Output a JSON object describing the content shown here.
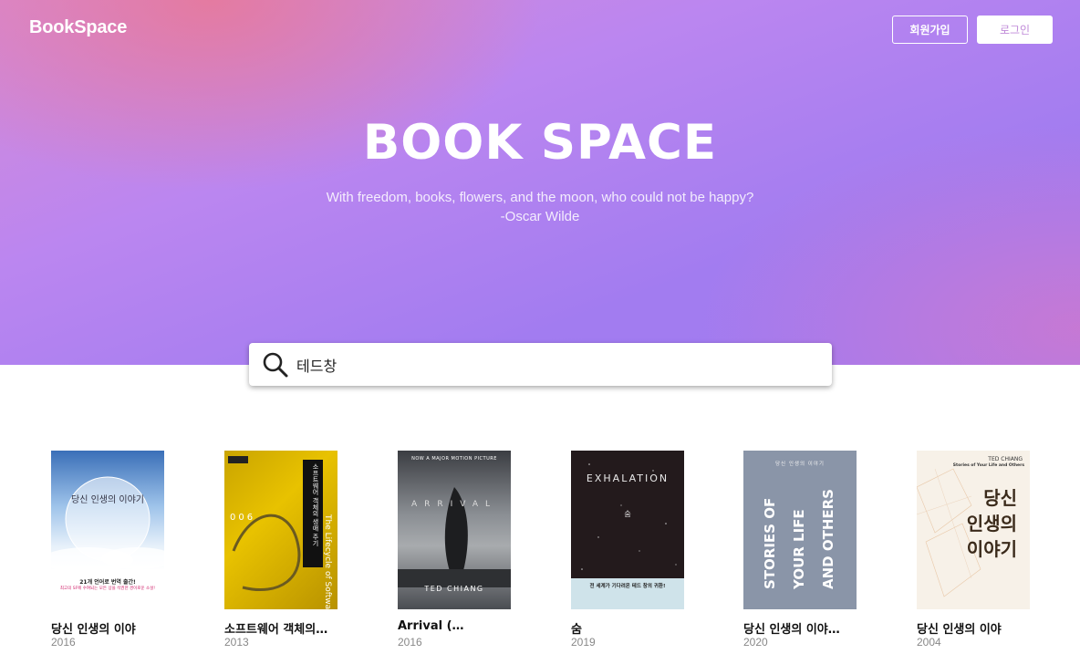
{
  "header": {
    "brand": "BookSpace",
    "signup_label": "회원가입",
    "login_label": "로그인"
  },
  "hero": {
    "title": "BOOK SPACE",
    "quote": "With freedom, books, flowers, and the moon, who could not be happy?",
    "author": "-Oscar Wilde"
  },
  "search": {
    "value": "테드창",
    "icon": "search-icon"
  },
  "books": [
    {
      "title": "당신 인생의 이야",
      "year": "2016",
      "cover": {
        "title": "당신 인생의 이야기",
        "line1": "21개 언어로 번역 출간!",
        "line2": "최고의 SF에 수여되는 모든 상을 석권한 경이로운 소설!"
      }
    },
    {
      "title": "소프트웨어 객체의…",
      "year": "2013",
      "cover": {
        "number": "006",
        "vertical_title": "소프트웨어 객체의 생애 주기",
        "spine_text": "The Lifecycle of Software Objects"
      }
    },
    {
      "title": "Arrival (…",
      "year": "2016",
      "cover": {
        "tagline": "NOW A MAJOR MOTION PICTURE",
        "title": "ARRIVAL",
        "author": "TED CHIANG"
      }
    },
    {
      "title": "숨",
      "year": "2019",
      "cover": {
        "title": "EXHALATION",
        "subtitle": "숨",
        "note": "전 세계가 기다려온 테드 창의 귀환!"
      }
    },
    {
      "title": "당신 인생의 이야…",
      "year": "2020",
      "cover": {
        "top": "당신 인생의 이야기",
        "line1": "STORIES OF",
        "line2": "YOUR LIFE",
        "line3": "AND OTHERS"
      }
    },
    {
      "title": "당신 인생의 이야",
      "year": "2004",
      "cover": {
        "author": "TED CHIANG",
        "subtitle": "Stories of Your Life and Others",
        "title_1": "당신",
        "title_2": "인생의",
        "title_3": "이야기"
      }
    }
  ]
}
